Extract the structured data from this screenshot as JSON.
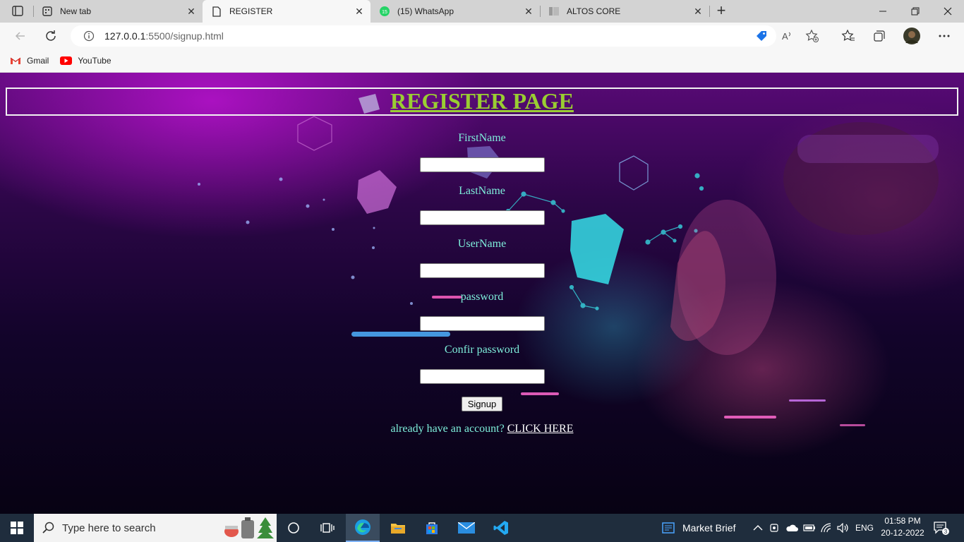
{
  "browser": {
    "tabs": [
      {
        "label": "New tab",
        "active": false
      },
      {
        "label": "REGISTER",
        "active": true
      },
      {
        "label": "(15) WhatsApp",
        "badge": "15",
        "active": false
      },
      {
        "label": "ALTOS CORE",
        "active": false
      }
    ],
    "close_glyph": "✕",
    "url_host": "127.0.0.1",
    "url_path": ":5500/signup.html",
    "bookmarks": [
      {
        "label": "Gmail",
        "icon": "gmail-icon"
      },
      {
        "label": "YouTube",
        "icon": "youtube-icon"
      }
    ]
  },
  "page": {
    "title": "REGISTER PAGE",
    "fields": [
      {
        "label": "FirstName",
        "value": ""
      },
      {
        "label": "LastName",
        "value": ""
      },
      {
        "label": "UserName",
        "value": ""
      },
      {
        "label": "password",
        "value": ""
      },
      {
        "label": "Confir password",
        "value": ""
      }
    ],
    "signup_label": "Signup",
    "account_text": "already have an account?",
    "click_here_label": "CLICK HERE"
  },
  "taskbar": {
    "search_placeholder": "Type here to search",
    "market_label": "Market Brief",
    "language": "ENG",
    "time": "01:58 PM",
    "date": "20-12-2022",
    "notification_count": "3"
  },
  "colors": {
    "title": "#9acd32",
    "label": "#7ff0dc",
    "link": "#ffffff",
    "taskbar": "#1f2d3d"
  }
}
